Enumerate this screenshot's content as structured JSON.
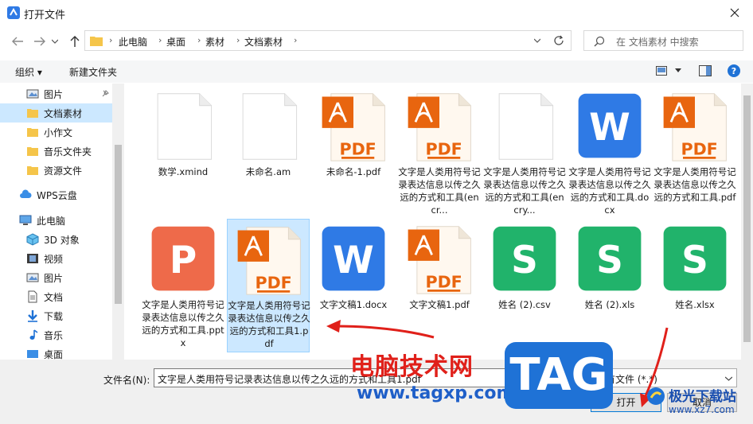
{
  "window": {
    "title": "打开文件"
  },
  "address": {
    "segments": [
      "此电脑",
      "桌面",
      "素材",
      "文档素材"
    ]
  },
  "search": {
    "placeholder": "在 文档素材 中搜索"
  },
  "toolbar": {
    "organize": "组织 ▾",
    "new_folder": "新建文件夹"
  },
  "sidebar": {
    "items": [
      {
        "label": "图片",
        "icon": "picture-icon"
      },
      {
        "label": "文档素材",
        "icon": "folder-icon",
        "selected": true
      },
      {
        "label": "小作文",
        "icon": "folder-icon"
      },
      {
        "label": "音乐文件夹",
        "icon": "folder-icon"
      },
      {
        "label": "资源文件",
        "icon": "folder-icon"
      },
      {
        "label": "WPS云盘",
        "icon": "cloud-icon"
      },
      {
        "label": "此电脑",
        "icon": "computer-icon"
      },
      {
        "label": "3D 对象",
        "icon": "cube-icon"
      },
      {
        "label": "视频",
        "icon": "video-icon"
      },
      {
        "label": "图片",
        "icon": "picture-icon"
      },
      {
        "label": "文档",
        "icon": "document-icon"
      },
      {
        "label": "下载",
        "icon": "download-icon"
      },
      {
        "label": "音乐",
        "icon": "music-icon"
      },
      {
        "label": "桌面",
        "icon": "desktop-icon"
      }
    ]
  },
  "files": [
    {
      "name": "数学.xmind",
      "type": "blank"
    },
    {
      "name": "未命名.am",
      "type": "blank"
    },
    {
      "name": "未命名-1.pdf",
      "type": "pdf"
    },
    {
      "name": "文字是人类用符号记录表达信息以传之久远的方式和工具(encr...",
      "type": "pdf"
    },
    {
      "name": "文字是人类用符号记录表达信息以传之久远的方式和工具(encry...",
      "type": "blank"
    },
    {
      "name": "文字是人类用符号记录表达信息以传之久远的方式和工具.docx",
      "type": "word"
    },
    {
      "name": "文字是人类用符号记录表达信息以传之久远的方式和工具.pdf",
      "type": "pdf"
    },
    {
      "name": "文字是人类用符号记录表达信息以传之久远的方式和工具.pptx",
      "type": "ppt"
    },
    {
      "name": "文字是人类用符号记录表达信息以传之久远的方式和工具1.pdf",
      "type": "pdf",
      "selected": true
    },
    {
      "name": "文字文稿1.docx",
      "type": "word"
    },
    {
      "name": "文字文稿1.pdf",
      "type": "pdf"
    },
    {
      "name": "姓名 (2).csv",
      "type": "sheet"
    },
    {
      "name": "姓名 (2).xls",
      "type": "sheet"
    },
    {
      "name": "姓名.xlsx",
      "type": "sheet"
    }
  ],
  "bottom": {
    "filename_label": "文件名(N):",
    "filename_value": "文字是人类用符号记录表达信息以传之久远的方式和工具1.pdf",
    "filetype_value": "所有文件 (*.*)",
    "open_label": "打开",
    "cancel_label": "取消"
  },
  "watermark": {
    "site_name": "电脑技术网",
    "site_url": "www.tagxp.com",
    "tag": "TAG",
    "jg_name": "极光下载站",
    "jg_url": "www.xz7.com"
  },
  "colors": {
    "pdf": "#e8650f",
    "word": "#2f7ae5",
    "ppt": "#ee6a4a",
    "sheet": "#21b36b",
    "accent": "#0078d7"
  }
}
